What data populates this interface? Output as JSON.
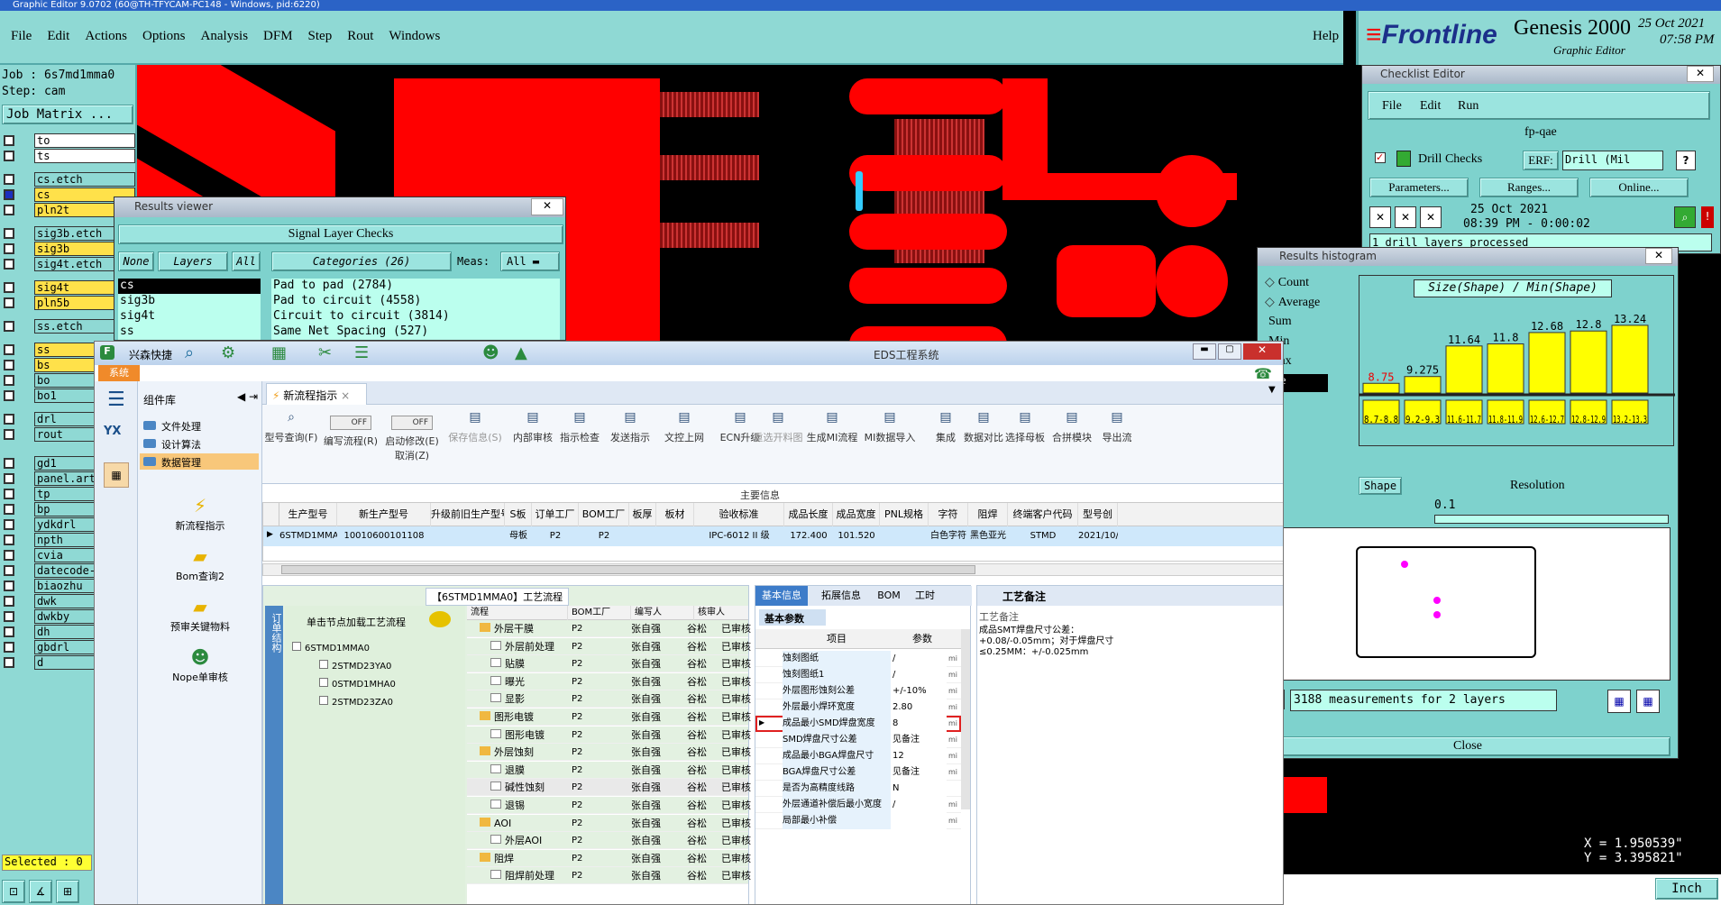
{
  "titlebar": {
    "text": "Graphic Editor 9.0702 (60@TH-TFYCAM-PC148 - Windows, pid:6220)"
  },
  "menu": [
    "File",
    "Edit",
    "Actions",
    "Options",
    "Analysis",
    "DFM",
    "Step",
    "Rout",
    "Windows"
  ],
  "help": "Help",
  "brand": {
    "logo": "Frontline",
    "product": "Genesis 2000",
    "sub": "Graphic Editor",
    "date": "25 Oct 2021",
    "time": "07:58 PM"
  },
  "job": {
    "job_line": "Job : 6s7md1mma0",
    "step_line": "Step: cam",
    "matrix_button": "Job Matrix ..."
  },
  "layers": [
    "to",
    "ts",
    "cs.etch",
    "cs",
    "pln2t",
    "sig3b.etch",
    "sig3b",
    "sig4t.etch",
    "sig4t",
    "pln5b",
    "ss.etch",
    "ss",
    "bs",
    "bo",
    "bo1",
    "drl",
    "rout",
    "gd1",
    "panel.art",
    "tp",
    "bp",
    "ydkdrl",
    "npth",
    "cvia",
    "datecode-",
    "biaozhu",
    "dwk",
    "dwkby",
    "dh",
    "gbdrl",
    "d"
  ],
  "selected": "Selected : 0",
  "results_viewer": {
    "title": "Results viewer",
    "header": "Signal Layer Checks",
    "none": "None",
    "layers": "Layers",
    "all": "All",
    "categories": "Categories (26)",
    "meas_label": "Meas:",
    "meas_value": "All",
    "layer_list": [
      "cs",
      "sig3b",
      "sig4t",
      "ss"
    ],
    "category_list": [
      "Pad to pad (2784)",
      "Pad to circuit (4558)",
      "Circuit to circuit (3814)",
      "Same Net Spacing (527)"
    ]
  },
  "checklist": {
    "title": "Checklist Editor",
    "menu": [
      "File",
      "Edit",
      "Run"
    ],
    "name": "fp-qae",
    "item": "Drill Checks",
    "erf_label": "ERF:",
    "erf_value": "Drill (Mil",
    "buttons": [
      "Parameters...",
      "Ranges...",
      "Online..."
    ],
    "run_date": "25 Oct 2021",
    "run_time": "08:39 PM - 0:00:02",
    "status": "1 drill layers processed"
  },
  "histogram": {
    "title": "Results histogram",
    "options": [
      "Count",
      "Average",
      "Sum",
      "Min",
      "Max",
      "ape"
    ],
    "chart_title": "Size(Shape) / Min(Shape)",
    "shape_label": "Shape",
    "resolution_label": "Resolution",
    "resolution_value": "0.1",
    "measurements": "3188 measurements for 2 layers",
    "close": "Close",
    "chart_data": {
      "type": "bar",
      "title": "Size(Shape) / Min(Shape)",
      "categories": [
        "8.7-8.8",
        "9.2-9.3",
        "11.6-11.7",
        "11.8-11.9",
        "12.6-12.7",
        "12.8-12.9",
        "13.2-13.3"
      ],
      "values": [
        8.75,
        9.275,
        11.64,
        11.8,
        12.68,
        12.8,
        13.24
      ],
      "value_labels": [
        "8.75",
        "9.275",
        "11.64",
        "11.8",
        "12.68",
        "12.8",
        "13.24"
      ],
      "ylim": [
        0,
        14
      ]
    }
  },
  "coords": {
    "x": "X = 1.950539\"",
    "y": "Y = 3.395821\"",
    "unit": "Inch"
  },
  "eds": {
    "title": "EDS工程系统",
    "brand": "兴森快捷",
    "tab_system": "系统",
    "sidebar_title": "组件库",
    "sidebar_items": [
      "文件处理",
      "设计算法",
      "数据管理"
    ],
    "tools": [
      "新流程指示",
      "Bom查询2",
      "预审关键物料",
      "Nope单审核"
    ],
    "active_tab": "新流程指示",
    "ribbon": [
      "型号查询(F)",
      "编写流程(R)",
      "启动修改(E)",
      "保存信息(S)",
      "内部审核",
      "指示检查",
      "发送指示",
      "文控上网",
      "ECN升级",
      "重选开料图",
      "生成MI流程",
      "MI数据导入",
      "集成",
      "数据对比",
      "选择母板",
      "合拼模块",
      "导出流"
    ],
    "toggle_off": "OFF",
    "cancel_label": "取消(Z)",
    "main_info": "主要信息",
    "table_headers": [
      "生产型号",
      "新生产型号",
      "升级前旧生产型号",
      "S板",
      "订单工厂",
      "BOM工厂",
      "板厚",
      "板材",
      "验收标准",
      "成品长度",
      "成品宽度",
      "PNL规格",
      "字符",
      "阻焊",
      "终端客户代码",
      "型号创"
    ],
    "table_row": [
      "6STMD1MMA0",
      "10010600101108",
      "",
      "母板",
      "P2",
      "P2",
      "",
      "",
      "IPC-6012 II 级",
      "172.400",
      "101.520",
      "",
      "白色字符",
      "黑色亚光",
      "STMD",
      "2021/10/"
    ],
    "flow_title": "【6STMD1MMA0】工艺流程",
    "tree_hint": "单击节点加载工艺流程",
    "side_label": "订单结构",
    "tree": [
      "6STMD1MMA0",
      "2STMD23YA0",
      "0STMD1MHA0",
      "2STMD23ZA0"
    ],
    "flow_headers": [
      "流程",
      "BOM工厂",
      "编写人",
      "核审人",
      "状态"
    ],
    "flow_rows": [
      {
        "name": "外层干膜",
        "level": 0,
        "bom": "P2",
        "w": "张自强",
        "r": "谷松",
        "s": "已审核"
      },
      {
        "name": "外层前处理",
        "level": 1,
        "bom": "P2",
        "w": "张自强",
        "r": "谷松",
        "s": "已审核"
      },
      {
        "name": "贴膜",
        "level": 1,
        "bom": "P2",
        "w": "张自强",
        "r": "谷松",
        "s": "已审核"
      },
      {
        "name": "曝光",
        "level": 1,
        "bom": "P2",
        "w": "张自强",
        "r": "谷松",
        "s": "已审核"
      },
      {
        "name": "显影",
        "level": 1,
        "bom": "P2",
        "w": "张自强",
        "r": "谷松",
        "s": "已审核"
      },
      {
        "name": "图形电镀",
        "level": 0,
        "bom": "P2",
        "w": "张自强",
        "r": "谷松",
        "s": "已审核"
      },
      {
        "name": "图形电镀",
        "level": 1,
        "bom": "P2",
        "w": "张自强",
        "r": "谷松",
        "s": "已审核"
      },
      {
        "name": "外层蚀刻",
        "level": 0,
        "bom": "P2",
        "w": "张自强",
        "r": "谷松",
        "s": "已审核"
      },
      {
        "name": "退膜",
        "level": 1,
        "bom": "P2",
        "w": "张自强",
        "r": "谷松",
        "s": "已审核"
      },
      {
        "name": "碱性蚀刻",
        "level": 1,
        "bom": "P2",
        "w": "张自强",
        "r": "谷松",
        "s": "已审核"
      },
      {
        "name": "退锡",
        "level": 1,
        "bom": "P2",
        "w": "张自强",
        "r": "谷松",
        "s": "已审核"
      },
      {
        "name": "AOI",
        "level": 0,
        "bom": "P2",
        "w": "张自强",
        "r": "谷松",
        "s": "已审核"
      },
      {
        "name": "外层AOI",
        "level": 1,
        "bom": "P2",
        "w": "张自强",
        "r": "谷松",
        "s": "已审核"
      },
      {
        "name": "阻焊",
        "level": 0,
        "bom": "P2",
        "w": "张自强",
        "r": "谷松",
        "s": "已审核"
      },
      {
        "name": "阻焊前处理",
        "level": 1,
        "bom": "P2",
        "w": "张自强",
        "r": "谷松",
        "s": "已审核"
      }
    ],
    "info_tabs": [
      "基本信息",
      "拓展信息",
      "BOM",
      "工时"
    ],
    "basic_params": "基本参数",
    "param_headers": [
      "项目",
      "参数"
    ],
    "params": [
      {
        "item": "蚀刻图纸",
        "value": "/",
        "unit": "mi"
      },
      {
        "item": "蚀刻图纸1",
        "value": "/",
        "unit": "mi"
      },
      {
        "item": "外层图形蚀刻公差",
        "value": "+/-10%",
        "unit": "mi"
      },
      {
        "item": "外层最小焊环宽度",
        "value": "2.80",
        "unit": "mi"
      },
      {
        "item": "成品最小SMD焊盘宽度",
        "value": "8",
        "unit": "mi"
      },
      {
        "item": "SMD焊盘尺寸公差",
        "value": "见备注",
        "unit": "mi"
      },
      {
        "item": "成品最小BGA焊盘尺寸",
        "value": "12",
        "unit": "mi"
      },
      {
        "item": "BGA焊盘尺寸公差",
        "value": "见备注",
        "unit": "mi"
      },
      {
        "item": "是否为高精度线路",
        "value": "N",
        "unit": ""
      },
      {
        "item": "外层通道补偿后最小宽度",
        "value": "/",
        "unit": "mi"
      },
      {
        "item": "局部最小补偿",
        "value": "",
        "unit": "mi"
      }
    ],
    "remark_title": "工艺备注",
    "remark_label": "工艺备注",
    "remark_text": "成品SMT焊盘尺寸公差：+0.08/-0.05mm；对于焊盘尺寸≤0.25MM：+/-0.025mm"
  }
}
